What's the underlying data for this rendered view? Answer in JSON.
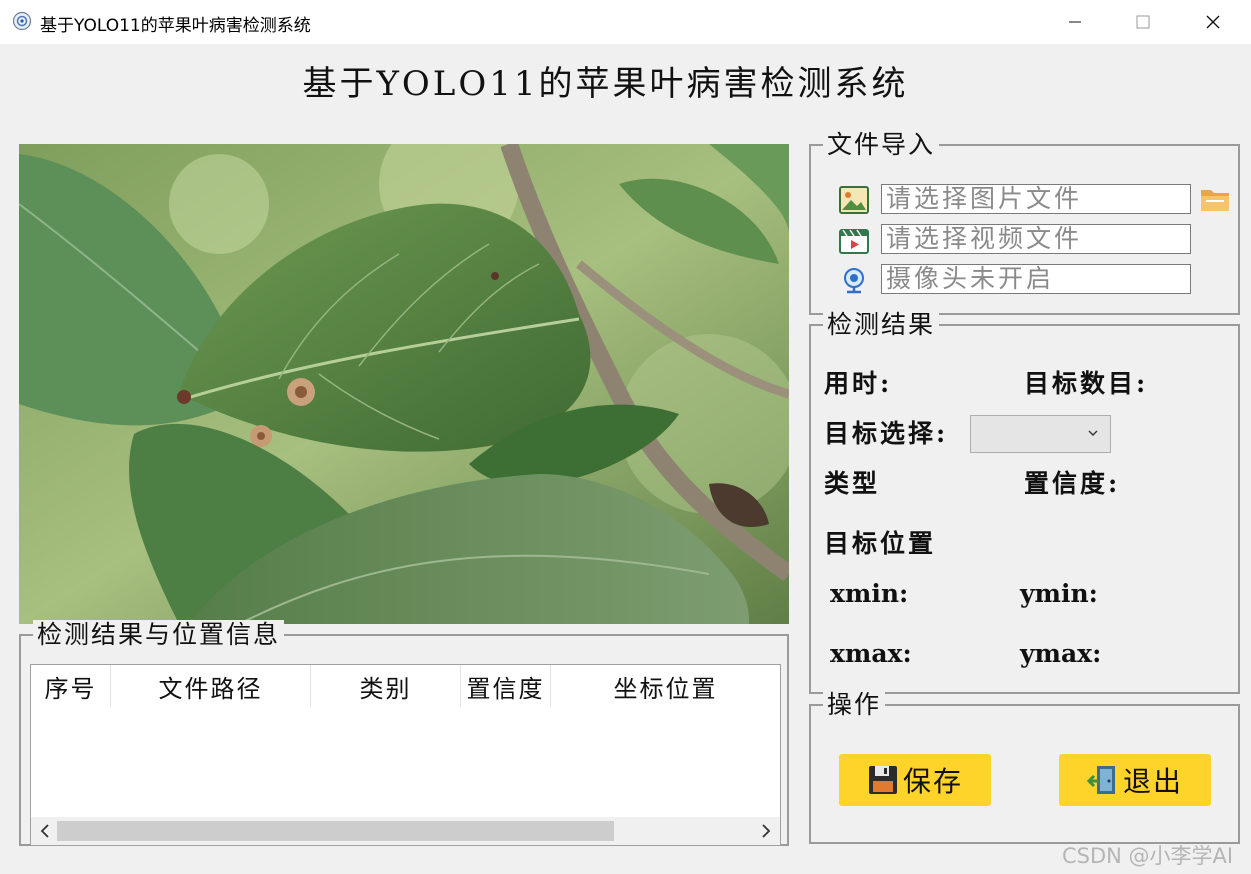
{
  "window": {
    "title": "基于YOLO11的苹果叶病害检测系统",
    "icon": "app-icon",
    "controls": [
      "minimize-icon",
      "maximize-icon",
      "close-icon"
    ]
  },
  "header": {
    "title": "基于YOLO11的苹果叶病害检测系统"
  },
  "file_import": {
    "title": "文件导入",
    "image_placeholder": "请选择图片文件",
    "video_placeholder": "请选择视频文件",
    "camera_status": "摄像头未开启",
    "icons": [
      "picture-icon",
      "video-icon",
      "webcam-icon",
      "folder-icon"
    ]
  },
  "detection": {
    "title": "检测结果",
    "time_label": "用时:",
    "count_label": "目标数目:",
    "select_label": "目标选择:",
    "type_label": "类型",
    "confidence_label": "置信度:",
    "position_label": "目标位置",
    "xmin_label": "xmin:",
    "ymin_label": "ymin:",
    "xmax_label": "xmax:",
    "ymax_label": "ymax:"
  },
  "operations": {
    "title": "操作",
    "save_label": "保存",
    "exit_label": "退出",
    "button_color": "#ffd42a"
  },
  "results_table": {
    "title": "检测结果与位置信息",
    "columns": [
      "序号",
      "文件路径",
      "类别",
      "置信度",
      "坐标位置"
    ],
    "rows": []
  },
  "watermark": "CSDN @小李学AI"
}
